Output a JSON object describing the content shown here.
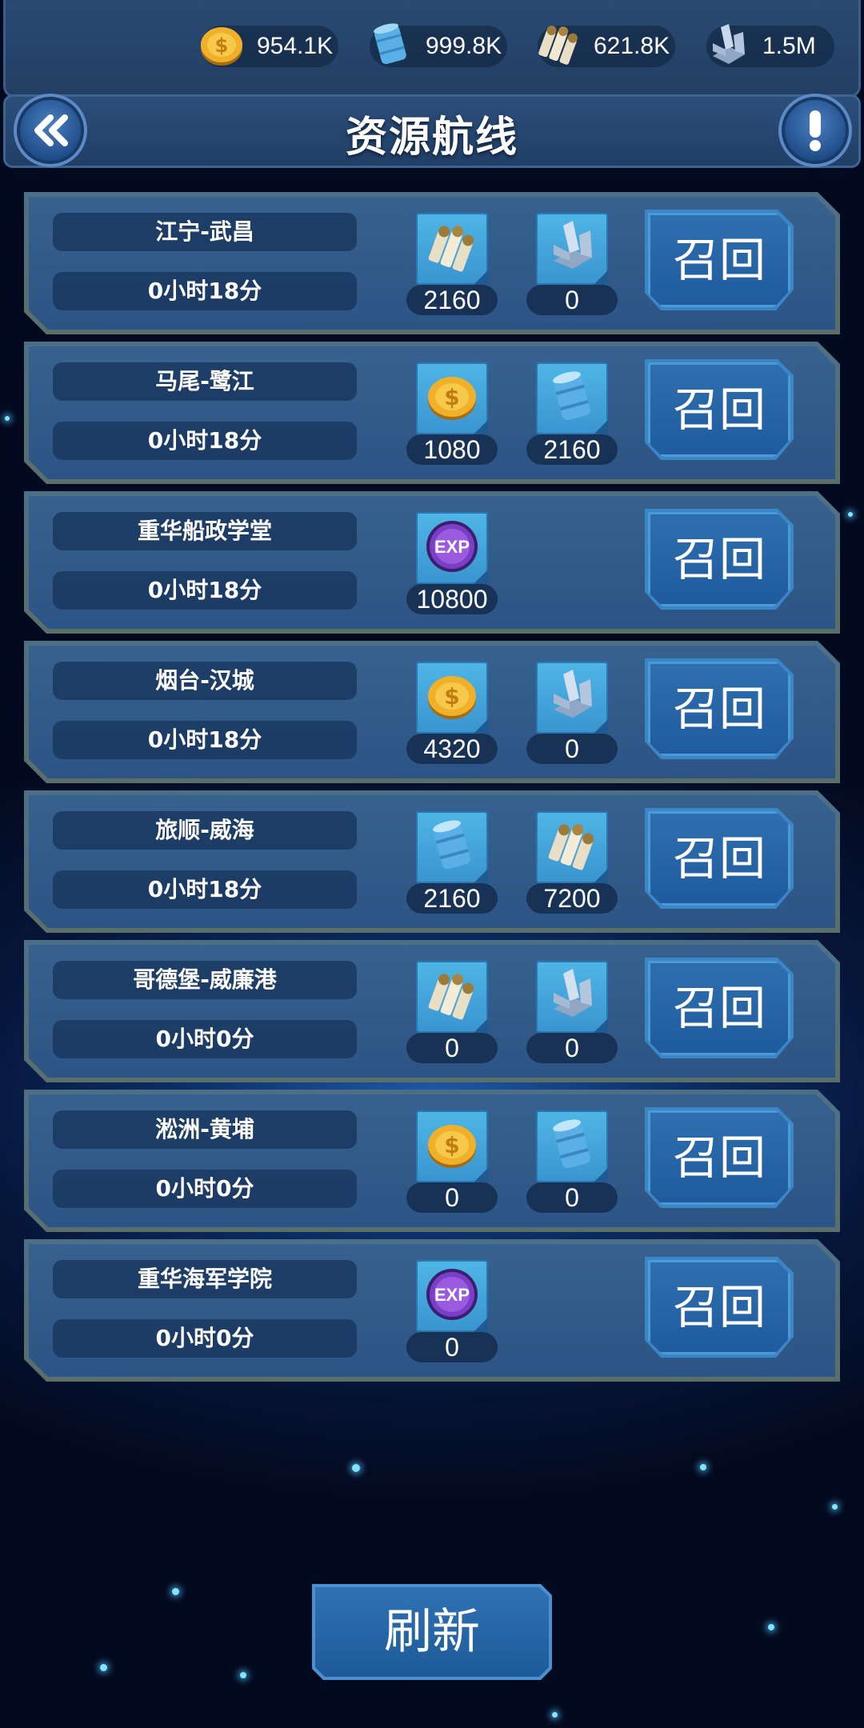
{
  "resources": [
    {
      "icon": "gold-coin-icon",
      "value": "954.1K"
    },
    {
      "icon": "oil-barrel-icon",
      "value": "999.8K"
    },
    {
      "icon": "ammo-shells-icon",
      "value": "621.8K"
    },
    {
      "icon": "steel-icon",
      "value": "1.5M"
    }
  ],
  "header": {
    "title": "资源航线"
  },
  "routes": [
    {
      "name": "江宁-武昌",
      "time": "0小时18分",
      "rewards": [
        {
          "icon": "ammo-shells-icon",
          "amount": "2160"
        },
        {
          "icon": "steel-icon",
          "amount": "0"
        }
      ],
      "recall_label": "召回"
    },
    {
      "name": "马尾-鹭江",
      "time": "0小时18分",
      "rewards": [
        {
          "icon": "gold-coin-icon",
          "amount": "1080"
        },
        {
          "icon": "oil-barrel-icon",
          "amount": "2160"
        }
      ],
      "recall_label": "召回"
    },
    {
      "name": "重华船政学堂",
      "time": "0小时18分",
      "rewards": [
        {
          "icon": "exp-icon",
          "amount": "10800"
        }
      ],
      "recall_label": "召回"
    },
    {
      "name": "烟台-汉城",
      "time": "0小时18分",
      "rewards": [
        {
          "icon": "gold-coin-icon",
          "amount": "4320"
        },
        {
          "icon": "steel-icon",
          "amount": "0"
        }
      ],
      "recall_label": "召回"
    },
    {
      "name": "旅顺-威海",
      "time": "0小时18分",
      "rewards": [
        {
          "icon": "oil-barrel-icon",
          "amount": "2160"
        },
        {
          "icon": "ammo-shells-icon",
          "amount": "7200"
        }
      ],
      "recall_label": "召回"
    },
    {
      "name": "哥德堡-威廉港",
      "time": "0小时0分",
      "rewards": [
        {
          "icon": "ammo-shells-icon",
          "amount": "0"
        },
        {
          "icon": "steel-icon",
          "amount": "0"
        }
      ],
      "recall_label": "召回"
    },
    {
      "name": "淞洲-黄埔",
      "time": "0小时0分",
      "rewards": [
        {
          "icon": "gold-coin-icon",
          "amount": "0"
        },
        {
          "icon": "oil-barrel-icon",
          "amount": "0"
        }
      ],
      "recall_label": "召回"
    },
    {
      "name": "重华海军学院",
      "time": "0小时0分",
      "rewards": [
        {
          "icon": "exp-icon",
          "amount": "0"
        }
      ],
      "recall_label": "召回"
    }
  ],
  "footer": {
    "refresh_label": "刷新"
  }
}
